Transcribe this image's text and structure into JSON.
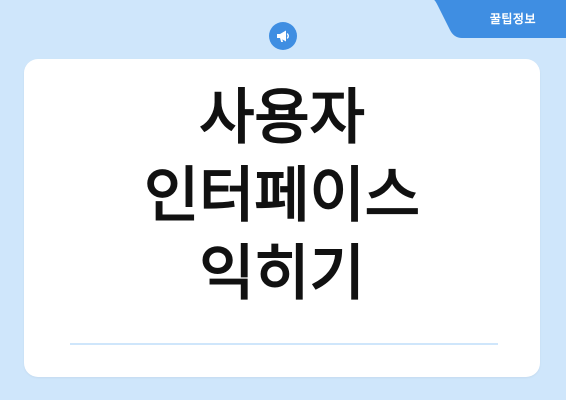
{
  "header": {
    "tab_label": "꿀팁정보",
    "icon": "megaphone-icon"
  },
  "card": {
    "title_lines": [
      "사용자",
      "인터페이스",
      "익히기"
    ]
  },
  "colors": {
    "background": "#cfe6fb",
    "accent": "#3f8ee2",
    "card": "#ffffff",
    "title_text": "#111111"
  }
}
